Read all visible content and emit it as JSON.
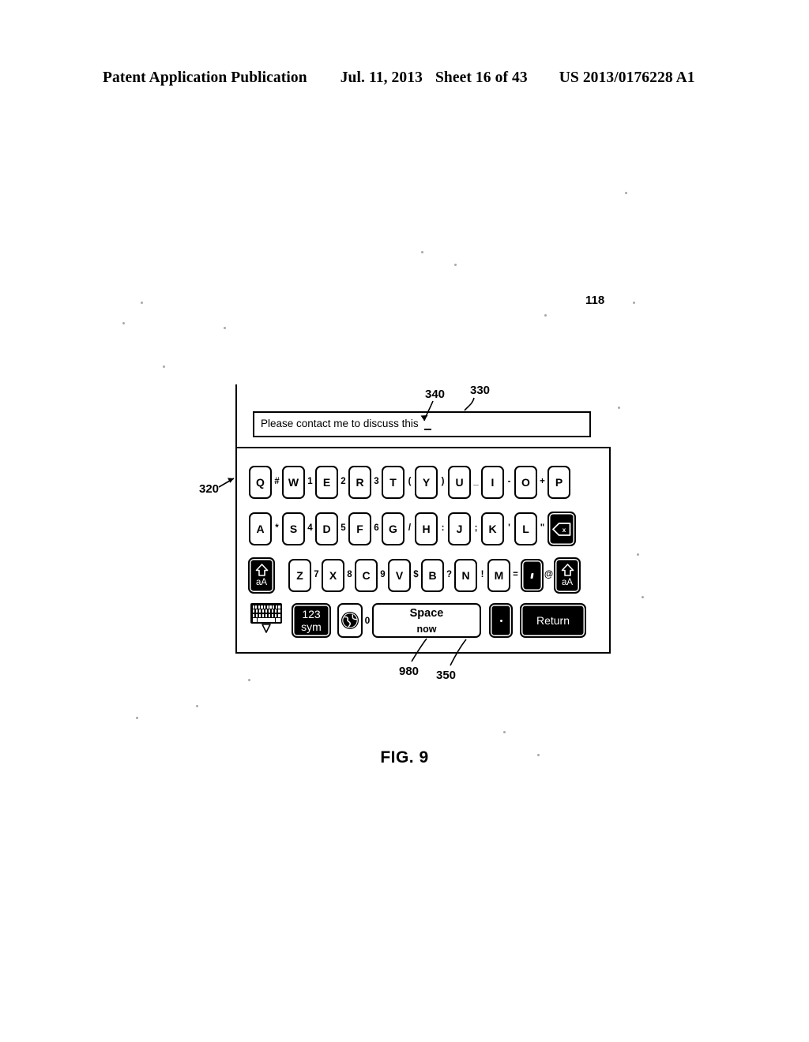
{
  "header": {
    "publication": "Patent Application Publication",
    "date": "Jul. 11, 2013",
    "sheet": "Sheet 16 of 43",
    "patent_number": "US 2013/0176228 A1"
  },
  "figure": {
    "caption": "FIG. 9",
    "reference_numerals": {
      "device": "118",
      "keyboard": "320",
      "text_field": "330",
      "cursor": "340",
      "space_key": "350",
      "suggestion": "980"
    }
  },
  "text_field": {
    "value": "Please contact me to discuss this",
    "cursor": "|"
  },
  "keyboard": {
    "row1": {
      "keys": [
        "Q",
        "W",
        "E",
        "R",
        "T",
        "Y",
        "U",
        "I",
        "O",
        "P"
      ],
      "symbols": [
        "#",
        "1",
        "2",
        "3",
        "(",
        ")",
        "_",
        "-",
        "+"
      ]
    },
    "row2": {
      "keys": [
        "A",
        "S",
        "D",
        "F",
        "G",
        "H",
        "J",
        "K",
        "L"
      ],
      "symbols": [
        "*",
        "4",
        "5",
        "6",
        "/",
        ":",
        ";",
        "'",
        "\""
      ],
      "backspace": "backspace-icon",
      "backspace_glyph": "x"
    },
    "row3": {
      "shift_left_label": "aA",
      "shift_right_label": "aA",
      "keys": [
        "Z",
        "X",
        "C",
        "V",
        "B",
        "N",
        "M"
      ],
      "symbols": [
        "7",
        "8",
        "9",
        "$",
        "?",
        "!",
        "="
      ],
      "comma_key": ",",
      "at_symbol": "@"
    },
    "row4": {
      "hide_keyboard": "hide-keyboard-icon",
      "sym_line1": "123",
      "sym_line2": "sym",
      "globe": "globe-icon",
      "zero": "0",
      "space_label": "Space",
      "space_suggestion": "now",
      "period": ".",
      "return_label": "Return"
    }
  },
  "colors": {
    "ink": "#000000",
    "paper": "#ffffff",
    "dark_key_fill": "#000000",
    "dark_key_text": "#ffffff"
  }
}
